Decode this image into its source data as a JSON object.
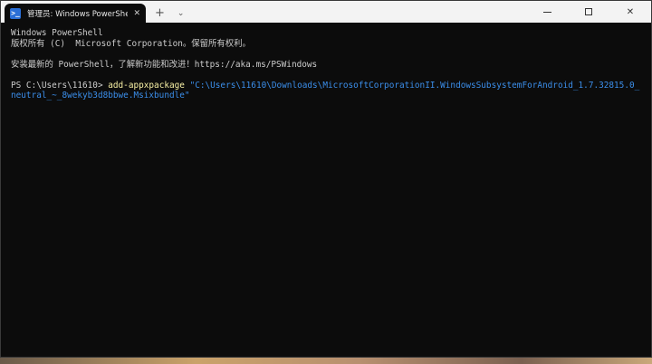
{
  "window": {
    "tab_icon_glyph": ">_",
    "tab_title": "管理员: Windows PowerShell",
    "tab_close_glyph": "✕",
    "new_tab_glyph": "+",
    "dropdown_glyph": "⌄",
    "minimize_label": "minimize",
    "maximize_label": "maximize",
    "close_glyph": "✕"
  },
  "terminal": {
    "line1": "Windows PowerShell",
    "line2": "版权所有 (C)  Microsoft Corporation。保留所有权利。",
    "line3": "安装最新的 PowerShell，了解新功能和改进！https://aka.ms/PSWindows",
    "prompt": "PS C:\\Users\\11610> ",
    "command": "add-appxpackage",
    "argument": " \"C:\\Users\\11610\\Downloads\\MicrosoftCorporationII.WindowsSubsystemForAndroid_1.7.32815.0_neutral_~_8wekyb3d8bbwe.Msixbundle\""
  },
  "colors": {
    "terminal_bg": "#0c0c0c",
    "terminal_fg": "#cccccc",
    "command": "#f9f1a5",
    "argument": "#3b8eea",
    "titlebar": "#f3f3f3"
  }
}
